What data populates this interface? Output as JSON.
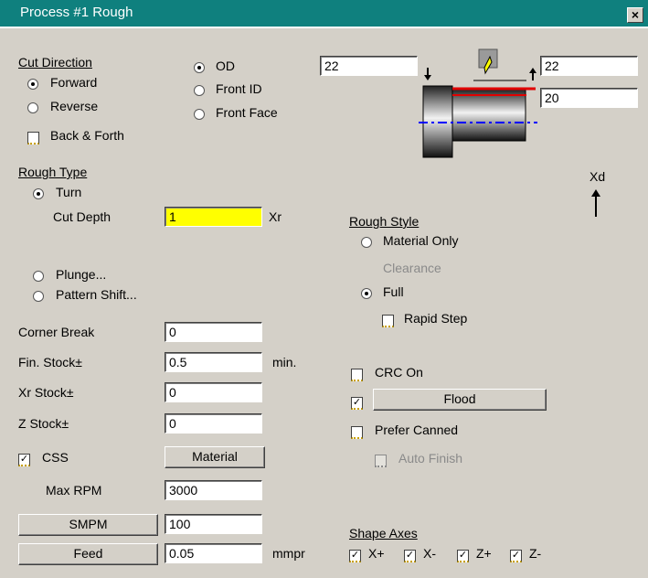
{
  "window": {
    "title": "Process #1 Rough",
    "close_icon": "×"
  },
  "colors": {
    "titlebar": "#0f807e",
    "highlight": "#ffff00"
  },
  "cut_direction": {
    "label": "Cut Direction",
    "forward": "Forward",
    "reverse": "Reverse",
    "selected": "Forward",
    "back_and_forth": "Back & Forth",
    "back_and_forth_checked": false
  },
  "cut_location": {
    "od": "OD",
    "front_id": "Front ID",
    "front_face": "Front Face",
    "selected": "OD"
  },
  "diagram": {
    "left_value": "22",
    "right_top_value": "22",
    "right_bottom_value": "20",
    "axis_label": "Xd"
  },
  "rough_type": {
    "label": "Rough Type",
    "turn": "Turn",
    "cut_depth_label": "Cut Depth",
    "cut_depth_value": "1",
    "cut_depth_unit": "Xr",
    "plunge": "Plunge...",
    "pattern_shift": "Pattern Shift...",
    "selected": "Turn"
  },
  "rough_style": {
    "label": "Rough Style",
    "material_only": "Material Only",
    "clearance": "Clearance",
    "full": "Full",
    "selected": "Full",
    "rapid_step": "Rapid Step",
    "rapid_step_checked": false
  },
  "params": {
    "corner_break_label": "Corner Break",
    "corner_break": "0",
    "fin_stock_label": "Fin. Stock±",
    "fin_stock": "0.5",
    "fin_stock_unit": "min.",
    "xr_stock_label": "Xr Stock±",
    "xr_stock": "0",
    "z_stock_label": "Z Stock±",
    "z_stock": "0"
  },
  "options": {
    "crc_on": "CRC On",
    "crc_on_checked": false,
    "flood_checked": true,
    "flood_button": "Flood",
    "prefer_canned": "Prefer Canned",
    "prefer_canned_checked": false,
    "auto_finish": "Auto Finish",
    "auto_finish_checked": false
  },
  "speed": {
    "css_label": "CSS",
    "css_checked": true,
    "material_button": "Material",
    "max_rpm_label": "Max RPM",
    "max_rpm": "3000",
    "smpm_button": "SMPM",
    "smpm": "100",
    "feed_button": "Feed",
    "feed": "0.05",
    "feed_unit": "mmpr"
  },
  "shape_axes": {
    "label": "Shape Axes",
    "x_plus": "X+",
    "x_minus": "X-",
    "z_plus": "Z+",
    "z_minus": "Z-",
    "check_mark": "✓"
  }
}
